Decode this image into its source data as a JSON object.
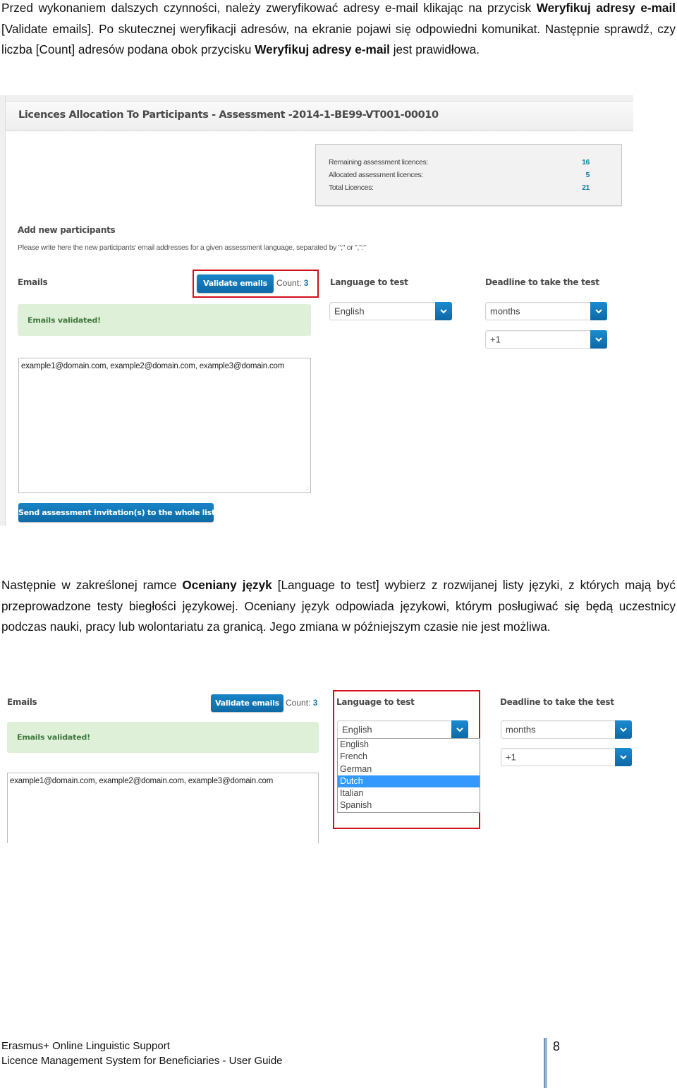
{
  "intro_paragraph": {
    "parts": [
      {
        "text": "Przed wykonaniem dalszych czynności, należy zweryfikować adresy e-mail klikając na przycisk ",
        "bold": false
      },
      {
        "text": "Weryfikuj adresy e-mail",
        "bold": true
      },
      {
        "text": " [Validate emails]. Po skutecznej weryfikacji adresów, na ekranie pojawi się odpowiedni komunikat. Następnie sprawdź, czy liczba [Count] adresów podana obok przycisku ",
        "bold": false
      },
      {
        "text": "Weryfikuj adresy e-mail",
        "bold": true
      },
      {
        "text": " jest prawidłowa.",
        "bold": false
      }
    ]
  },
  "screenshot1": {
    "title": "Licences Allocation To Participants - Assessment -2014-1-BE99-VT001-00010",
    "licences": [
      {
        "label": "Remaining assessment licences:",
        "value": "16"
      },
      {
        "label": "Allocated assessment licences:",
        "value": "5"
      },
      {
        "label": "Total Licences:",
        "value": "21"
      }
    ],
    "add_participants_heading": "Add new participants",
    "add_participants_note": "Please write here the new participants' email addresses for a given assessment language, separated by \";\" or \",\":\"",
    "emails_label": "Emails",
    "validate_button": "Validate emails",
    "count_label": "Count:",
    "count_value": "3",
    "language_label": "Language to test",
    "language_value": "English",
    "deadline_label": "Deadline to take the test",
    "deadline_unit_value": "months",
    "deadline_amount_value": "+1",
    "validated_message": "Emails validated!",
    "emails_textarea_value": "example1@domain.com, example2@domain.com, example3@domain.com",
    "send_button": "Send assessment invitation(s) to the whole list"
  },
  "second_paragraph": {
    "parts": [
      {
        "text": "Następnie w zakreślonej ramce ",
        "bold": false
      },
      {
        "text": "Oceniany język",
        "bold": true
      },
      {
        "text": " [Language to test] wybierz z rozwijanej listy języki, z których mają być przeprowadzone testy biegłości językowej. Oceniany język odpowiada językowi, którym posługiwać się będą uczestnicy podczas nauki, pracy lub wolontariatu za granicą. Jego zmiana w późniejszym czasie nie jest możliwa.",
        "bold": false
      }
    ]
  },
  "screenshot2": {
    "emails_label": "Emails",
    "validate_button": "Validate emails",
    "count_label": "Count:",
    "count_value": "3",
    "validated_message": "Emails validated!",
    "emails_textarea_value": "example1@domain.com, example2@domain.com, example3@domain.com",
    "language_label": "Language to test",
    "language_value": "English",
    "language_options": [
      "English",
      "French",
      "German",
      "Dutch",
      "Italian",
      "Spanish"
    ],
    "language_highlighted": "Dutch",
    "deadline_label": "Deadline to take the test",
    "deadline_unit_value": "months",
    "deadline_amount_value": "+1"
  },
  "footer": {
    "line1": "Erasmus+ Online Linguistic Support",
    "line2": "Licence Management System for Beneficiaries - User Guide",
    "page_number": "8"
  },
  "colors": {
    "highlight_border": "#d0111b",
    "button_blue": "#1278b8",
    "success_bg": "#dff0d8",
    "success_text": "#3c763d",
    "count_blue": "#1a7aaa",
    "dropdown_selected": "#3399ff"
  }
}
